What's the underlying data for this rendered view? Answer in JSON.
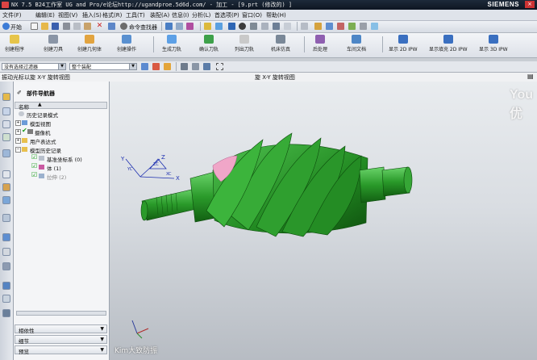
{
  "window": {
    "title": "NX 7.5 B24工作室   UG and Pro/e论坛http://ugandproe.5d6d.com/ - 加工 - [9.prt  (修改的) ]",
    "brand": "SIEMENS",
    "close_label": "×"
  },
  "menubar": {
    "items": [
      "文件(F)",
      "编辑(E)",
      "视图(V)",
      "插入(S)",
      "格式(R)",
      "工具(T)",
      "装配(A)",
      "信息(I)",
      "分析(L)",
      "首选项(P)",
      "窗口(O)",
      "帮助(H)"
    ]
  },
  "toolbar1": {
    "start_label": "开始",
    "finder_label": "命令查找器"
  },
  "toolbar2": {
    "buttons": [
      "创建程序",
      "创建刀具",
      "创建几何体",
      "创建操作",
      "生成刀轨",
      "确认刀轨",
      "列出刀轨",
      "机床仿真",
      "后处理",
      "车间文档",
      "显示 2D IPW",
      "显示填充 2D IPW",
      "显示 3D IPW"
    ]
  },
  "toolbar3": {
    "filter_value": "没有选择过滤器",
    "assembly_value": "整个装配"
  },
  "status": {
    "left_text": "振动光标以旋 X-Y 旋转视图",
    "center_text": "旋 X-Y 旋转视图"
  },
  "navigator": {
    "title": "部件导航器",
    "column_name": "名称",
    "tree": [
      {
        "label": "历史记录模式",
        "level": 0
      },
      {
        "label": "模型视图",
        "level": 0
      },
      {
        "label": "摄像机",
        "level": 0
      },
      {
        "label": "用户表达式",
        "level": 0
      },
      {
        "label": "模型历史记录",
        "level": 0
      },
      {
        "label": "基准坐标系 (0)",
        "level": 1
      },
      {
        "label": "体 (1)",
        "level": 1
      },
      {
        "label": "拉伸 (2)",
        "level": 1
      }
    ],
    "panels": [
      "相依性",
      "细节",
      "预览"
    ]
  },
  "viewport": {
    "watermark_top": "You 优",
    "watermark_bottom": "Kim大致防振",
    "triad_labels": [
      "X",
      "Y",
      "Z",
      "YC",
      "ZC",
      "XC"
    ]
  },
  "colors": {
    "part_green": "#2a9a2a",
    "part_green_dark": "#125f12",
    "highlight_pink": "#f0a6c8"
  }
}
